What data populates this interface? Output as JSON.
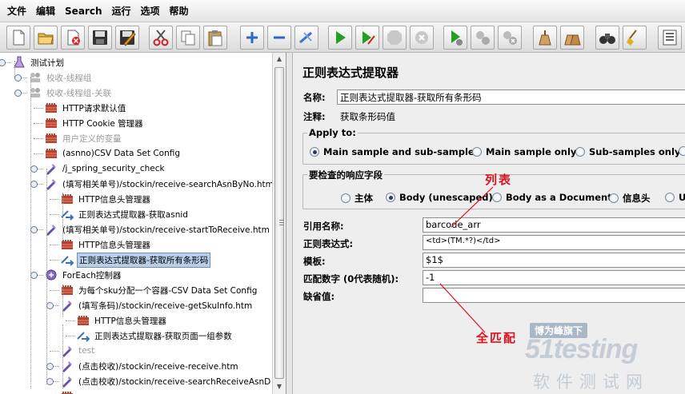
{
  "menu": [
    "文件",
    "编辑",
    "Search",
    "运行",
    "选项",
    "帮助"
  ],
  "toolbar": [
    "new-icon",
    "open-icon",
    "close-file-icon",
    "save-icon",
    "save-as-icon",
    "cut-icon",
    "copy-icon",
    "paste-icon",
    "expand-icon",
    "collapse-icon",
    "toggle-icon",
    "start-icon",
    "start-no-pause-icon",
    "stop-icon",
    "shutdown-icon",
    "remote-start-icon",
    "remote-stop-icon",
    "remote-shutdown-icon",
    "clear-icon",
    "clear-all-icon",
    "search-icon",
    "reset-search-icon",
    "function-helper-icon"
  ],
  "tree": [
    {
      "label": "测试计划",
      "icon": "test-plan-icon",
      "disabled": false
    },
    {
      "label": "校收-线程组",
      "icon": "thread-group-icon",
      "disabled": true
    },
    {
      "label": "校收-线程组-关联",
      "icon": "thread-group-icon",
      "disabled": true
    },
    {
      "label": "HTTP请求默认值",
      "icon": "config-element-icon",
      "disabled": false
    },
    {
      "label": "HTTP Cookie 管理器",
      "icon": "config-element-icon",
      "disabled": false
    },
    {
      "label": "用户定义的变量",
      "icon": "config-element-icon",
      "disabled": true
    },
    {
      "label": "(asnno)CSV Data Set Config",
      "icon": "config-element-icon",
      "disabled": false
    },
    {
      "label": "/j_spring_security_check",
      "icon": "sampler-icon",
      "disabled": false
    },
    {
      "label": "(填写相关单号)/stockin/receive-searchAsnByNo.htm",
      "icon": "sampler-icon",
      "disabled": false
    },
    {
      "label": "HTTP信息头管理器",
      "icon": "config-element-icon",
      "disabled": false
    },
    {
      "label": "正则表达式提取器-获取asnid",
      "icon": "extractor-icon",
      "disabled": false
    },
    {
      "label": "(填写相关单号)/stockin/receive-startToReceive.htm",
      "icon": "sampler-icon",
      "disabled": false
    },
    {
      "label": "HTTP信息头管理器",
      "icon": "config-element-icon",
      "disabled": false
    },
    {
      "label": "正则表达式提取器-获取所有条形码",
      "icon": "extractor-icon",
      "disabled": false
    },
    {
      "label": "ForEach控制器",
      "icon": "controller-icon",
      "disabled": false
    },
    {
      "label": "为每个sku分配一个容器-CSV Data Set Config",
      "icon": "config-element-icon",
      "disabled": false
    },
    {
      "label": "(填写条码)/stockin/receive-getSkuInfo.htm",
      "icon": "sampler-icon",
      "disabled": false
    },
    {
      "label": "HTTP信息头管理器",
      "icon": "config-element-icon",
      "disabled": false
    },
    {
      "label": "正则表达式提取器-获取页面一组参数",
      "icon": "extractor-icon",
      "disabled": false
    },
    {
      "label": "test",
      "icon": "sampler-icon",
      "disabled": true
    },
    {
      "label": "(点击校收)/stockin/receive-receive.htm",
      "icon": "sampler-icon",
      "disabled": false
    },
    {
      "label": "(点击校收)/stockin/receive-searchReceiveAsnD",
      "icon": "sampler-icon",
      "disabled": false
    },
    {
      "label": "",
      "icon": "config-element-icon",
      "disabled": false
    }
  ],
  "editor": {
    "title": "正则表达式提取器",
    "name_label": "名称:",
    "name_value": "正则表达式提取器-获取所有条形码",
    "comment_label": "注释:",
    "comment_value": "获取条形码值",
    "apply_to": {
      "title": "Apply to:",
      "options": [
        "Main sample and sub-samples",
        "Main sample only",
        "Sub-samples only",
        ""
      ],
      "selected": 0
    },
    "response_field": {
      "title": "要检查的响应字段",
      "options": [
        "主体",
        "Body (unescaped)",
        "Body as a Document",
        "信息头",
        "U"
      ],
      "selected": 1
    },
    "ref_name_label": "引用名称:",
    "ref_name_value": "barcode_arr",
    "regex_label": "正则表达式:",
    "regex_value": "<td>(TM.*?)</td>",
    "template_label": "模板:",
    "template_value": "$1$",
    "match_no_label": "匹配数字 (0代表随机):",
    "match_no_value": "-1",
    "default_label": "缺省值:",
    "default_value": ""
  },
  "annotations": {
    "list": "列表",
    "match_all": "全匹配"
  },
  "watermark": {
    "tagline": "博为峰旗下",
    "brand": "51testing",
    "cn": "软件测试网"
  },
  "colors": {
    "selection": "#b9cfe9",
    "annotation": "#e0101a",
    "watermark": "#c4cdd6"
  }
}
